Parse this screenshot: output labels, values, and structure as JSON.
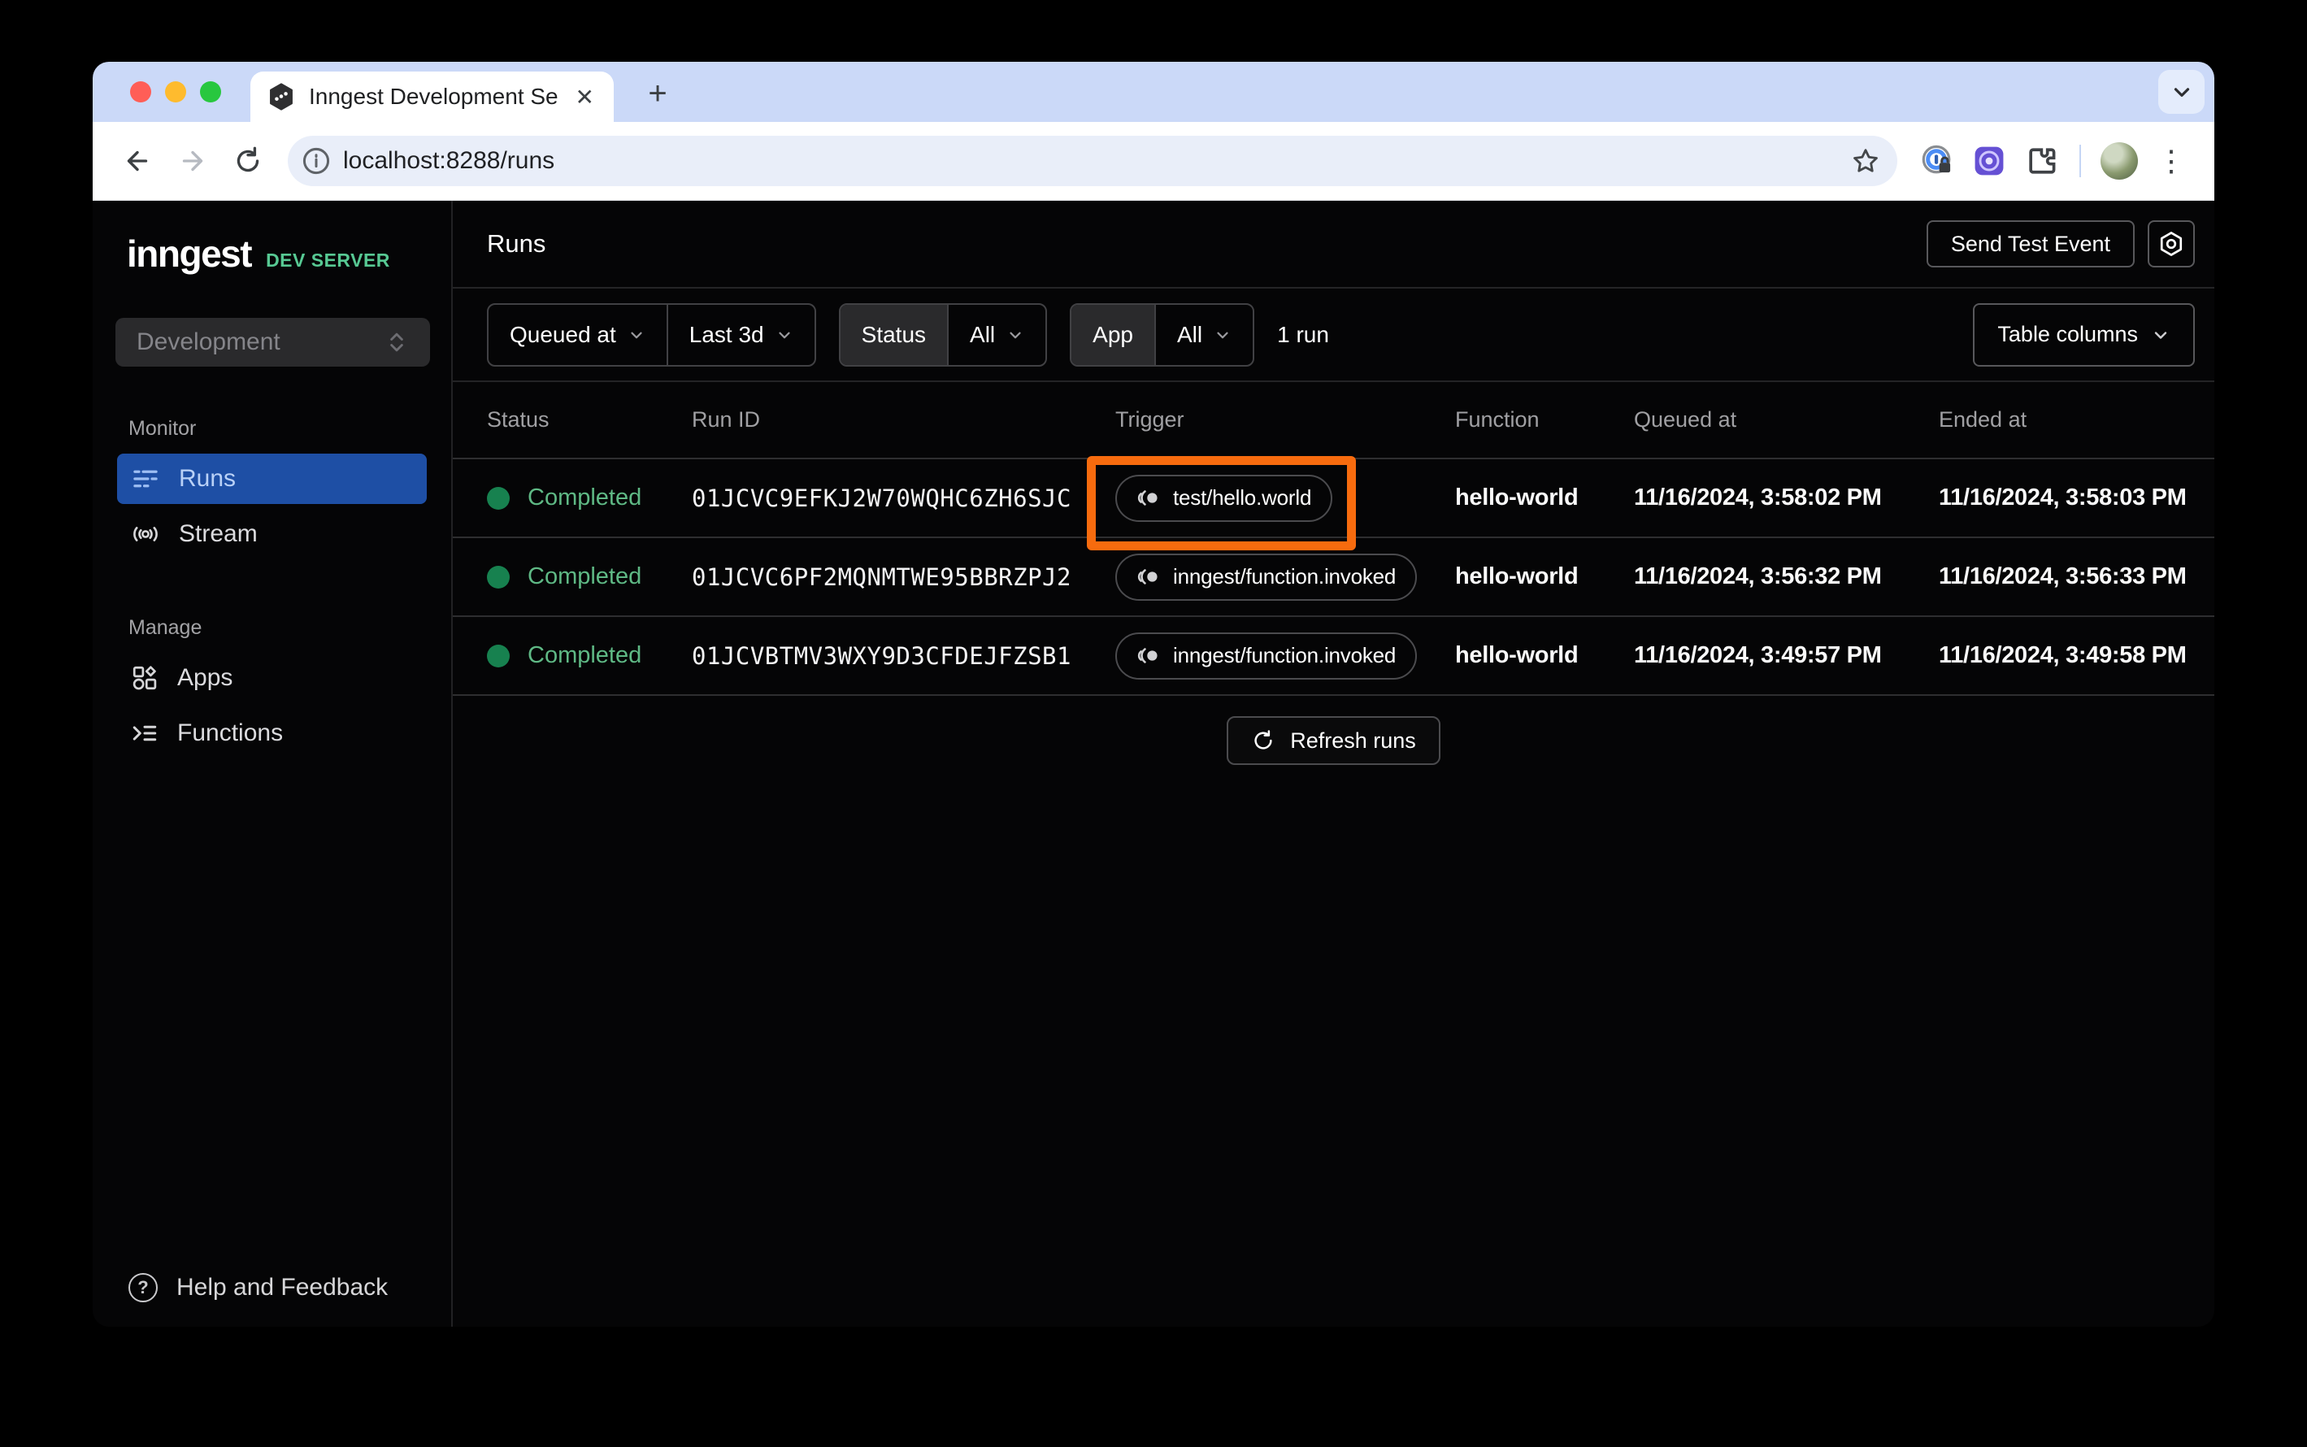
{
  "browser": {
    "tab_title": "Inngest Development Server",
    "url": "localhost:8288/runs",
    "icons": {
      "close_tab": "✕",
      "new_tab": "+",
      "kebab_menu": "⋮"
    }
  },
  "sidebar": {
    "logo": "inngest",
    "logo_badge": "DEV SERVER",
    "env_select": {
      "value": "Development"
    },
    "sections": [
      {
        "label": "Monitor",
        "items": [
          {
            "label": "Runs",
            "selected": true
          },
          {
            "label": "Stream",
            "selected": false
          }
        ]
      },
      {
        "label": "Manage",
        "items": [
          {
            "label": "Apps",
            "selected": false
          },
          {
            "label": "Functions",
            "selected": false
          }
        ]
      }
    ],
    "footer": {
      "help_label": "Help and Feedback",
      "question_glyph": "?"
    }
  },
  "header": {
    "title": "Runs",
    "send_test_event_label": "Send Test Event"
  },
  "filters": {
    "time_field": "Queued at",
    "time_range": "Last 3d",
    "status_label": "Status",
    "status_value": "All",
    "app_label": "App",
    "app_value": "All",
    "result_count": "1 run",
    "table_columns_label": "Table columns"
  },
  "table": {
    "columns": {
      "status": "Status",
      "run_id": "Run ID",
      "trigger": "Trigger",
      "function": "Function",
      "queued_at": "Queued at",
      "ended_at": "Ended at"
    },
    "rows": [
      {
        "status": "Completed",
        "run_id": "01JCVC9EFKJ2W70WQHC6ZH6SJC",
        "trigger": "test/hello.world",
        "function": "hello-world",
        "queued_at": "11/16/2024, 3:58:02 PM",
        "ended_at": "11/16/2024, 3:58:03 PM",
        "annotated": true
      },
      {
        "status": "Completed",
        "run_id": "01JCVC6PF2MQNMTWE95BBRZPJ2",
        "trigger": "inngest/function.invoked",
        "function": "hello-world",
        "queued_at": "11/16/2024, 3:56:32 PM",
        "ended_at": "11/16/2024, 3:56:33 PM",
        "annotated": false
      },
      {
        "status": "Completed",
        "run_id": "01JCVBTMV3WXY9D3CFDEJFZSB1",
        "trigger": "inngest/function.invoked",
        "function": "hello-world",
        "queued_at": "11/16/2024, 3:49:57 PM",
        "ended_at": "11/16/2024, 3:49:58 PM",
        "annotated": false
      }
    ],
    "refresh_label": "Refresh runs"
  },
  "colors": {
    "accent_selected": "#1e4fa5",
    "status_completed_text": "#5fb985",
    "status_completed_dot": "#17814f",
    "dev_server_green": "#57c993",
    "annotation_orange": "#f76b0e",
    "tabstrip_bg": "#cbd9f8",
    "content_bg": "#050506"
  }
}
